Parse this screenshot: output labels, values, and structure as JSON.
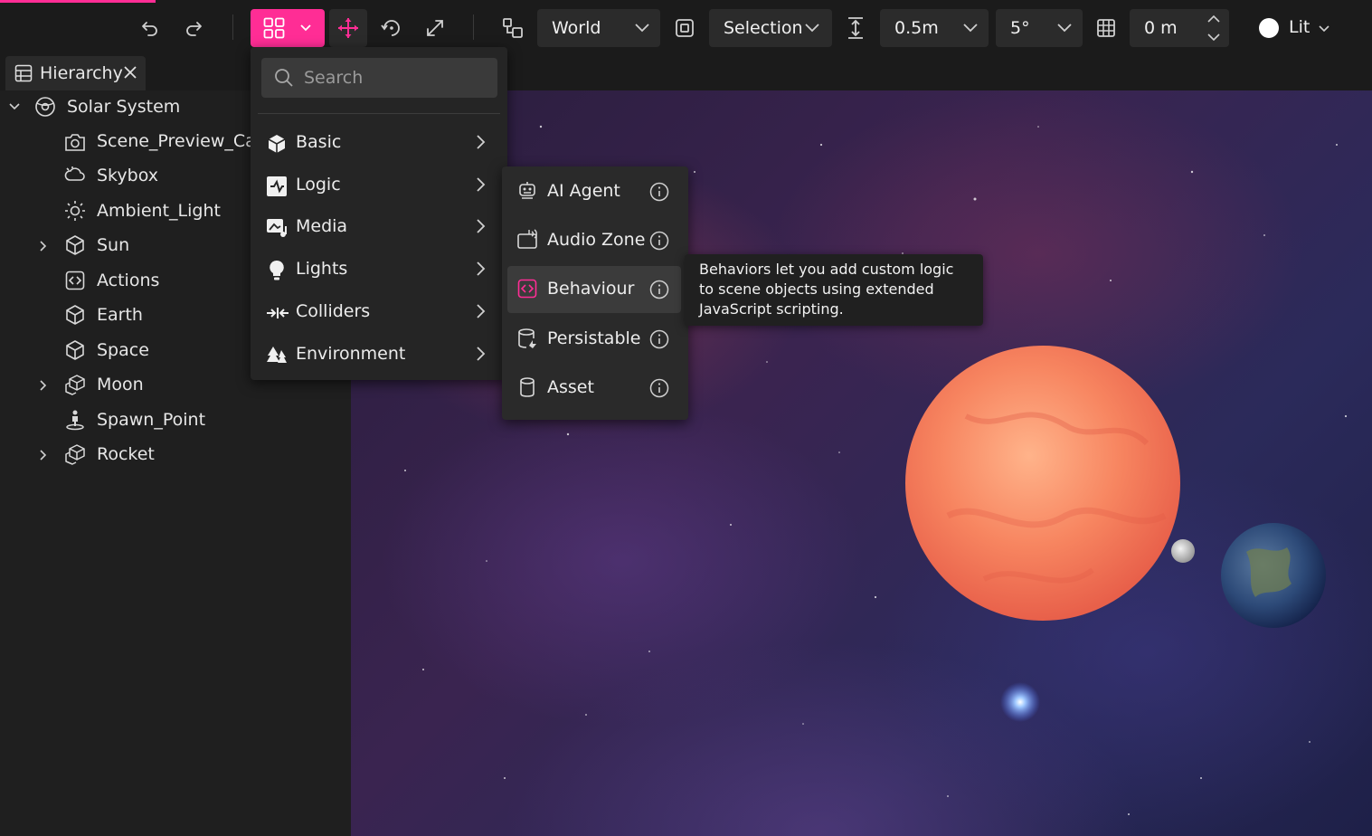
{
  "toolbar": {
    "space_mode": "World",
    "pivot_mode": "Selection",
    "snap_distance": "0.5m",
    "snap_angle": "5°",
    "grid_offset": "0 m",
    "lighting_mode": "Lit"
  },
  "colors": {
    "accent": "#ff2d95"
  },
  "tab": {
    "label": "Hierarchy"
  },
  "hierarchy": {
    "root": "Solar System",
    "items": [
      {
        "label": "Scene_Preview_Cam",
        "icon": "camera-icon"
      },
      {
        "label": "Skybox",
        "icon": "skybox-icon"
      },
      {
        "label": "Ambient_Light",
        "icon": "sun-light-icon"
      },
      {
        "label": "Sun",
        "icon": "cube-icon",
        "expandable": true
      },
      {
        "label": "Actions",
        "icon": "code-icon"
      },
      {
        "label": "Earth",
        "icon": "cube-icon"
      },
      {
        "label": "Space",
        "icon": "cube-icon"
      },
      {
        "label": "Moon",
        "icon": "cubes-icon",
        "expandable": true
      },
      {
        "label": "Spawn_Point",
        "icon": "person-icon"
      },
      {
        "label": "Rocket",
        "icon": "cubes-icon",
        "expandable": true
      }
    ]
  },
  "add_menu": {
    "search_placeholder": "Search",
    "categories": [
      "Basic",
      "Logic",
      "Media",
      "Lights",
      "Colliders",
      "Environment"
    ]
  },
  "logic_submenu": {
    "items": [
      "AI Agent",
      "Audio Zone",
      "Behaviour",
      "Persistable",
      "Asset"
    ],
    "active": "Behaviour"
  },
  "tooltip": {
    "text": "Behaviors let you add custom logic to scene objects using extended JavaScript scripting."
  }
}
